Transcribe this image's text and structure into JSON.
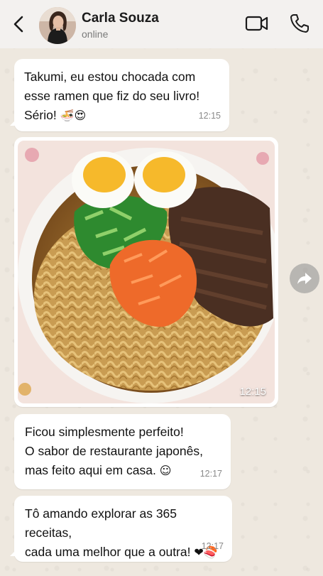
{
  "header": {
    "contact_name": "Carla Souza",
    "status": "online"
  },
  "messages": [
    {
      "type": "text",
      "text": "Takumi, eu estou chocada com\nesse ramen que fiz do seu livro!\nSério!",
      "emojis": "🍜😍",
      "time": "12:15"
    },
    {
      "type": "image",
      "image_description": "",
      "time": "12:15"
    },
    {
      "type": "text",
      "text": "Ficou simplesmente perfeito!\nO sabor de restaurante japonês,\nmas feito aqui em casa.",
      "emojis": "☺",
      "time": "12:17"
    },
    {
      "type": "text",
      "text": "Tô amando explorar as 365 receitas,\ncada uma melhor que a outra!",
      "emojis": "❤🍣",
      "time": "12:17"
    }
  ],
  "icons": {
    "back": "chevron-left-icon",
    "video": "video-camera-icon",
    "call": "phone-icon",
    "forward": "forward-arrow-icon"
  },
  "colors": {
    "header_bg": "#f3f1ef",
    "chat_bg": "#eee8df",
    "bubble_bg": "#ffffff",
    "time_text": "#8a8a8a"
  }
}
